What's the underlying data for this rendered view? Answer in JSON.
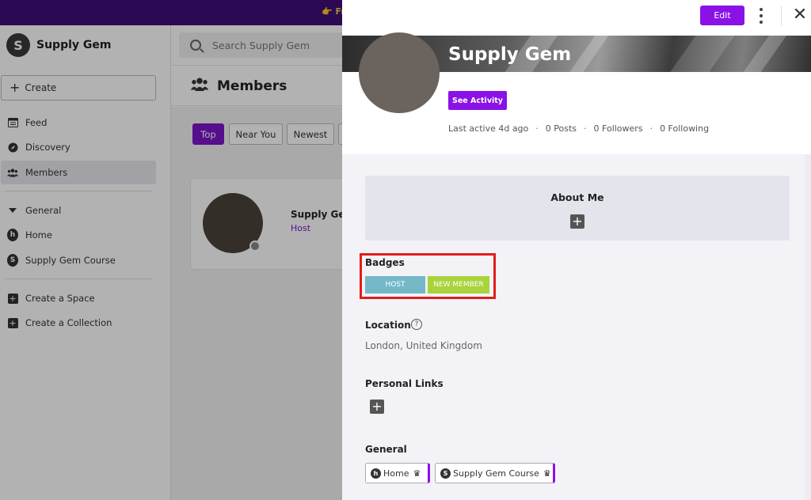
{
  "topbar": {
    "text": "👉 Fr"
  },
  "sidebar": {
    "brand": {
      "logo_letter": "S",
      "name": "Supply Gem"
    },
    "create_label": "Create",
    "items": [
      {
        "label": "Feed",
        "icon": "feed-icon"
      },
      {
        "label": "Discovery",
        "icon": "compass-icon"
      },
      {
        "label": "Members",
        "icon": "members-icon",
        "active": true
      }
    ],
    "group_label": "General",
    "spaces": [
      {
        "label": "Home",
        "icon_letter": "h"
      },
      {
        "label": "Supply Gem Course",
        "icon_letter": "S"
      }
    ],
    "actions": [
      {
        "label": "Create a Space"
      },
      {
        "label": "Create a Collection"
      }
    ]
  },
  "search": {
    "placeholder": "Search Supply Gem"
  },
  "main": {
    "title": "Members",
    "filters": [
      "Top",
      "Near You",
      "Newest"
    ],
    "active_filter": "Top",
    "member_card": {
      "name": "Supply Gem",
      "role": "Host"
    }
  },
  "panel": {
    "edit_label": "Edit",
    "close_symbol": "✕",
    "profile": {
      "name": "Supply Gem",
      "activity_button": "See Activity",
      "last_active": "Last active 4d ago",
      "posts": "0 Posts",
      "followers": "0 Followers",
      "following": "0 Following"
    },
    "about": {
      "title": "About Me"
    },
    "badges": {
      "title": "Badges",
      "items": [
        "HOST",
        "NEW MEMBER"
      ]
    },
    "location": {
      "title": "Location",
      "value": "London, United Kingdom"
    },
    "personal_links": {
      "title": "Personal Links"
    },
    "general": {
      "title": "General",
      "chips": [
        {
          "label": "Home",
          "icon_letter": "h"
        },
        {
          "label": "Supply Gem Course",
          "icon_letter": "S"
        }
      ]
    }
  },
  "colors": {
    "accent": "#8a12e6",
    "topbar": "#3f0f77",
    "badge_host": "#74b8c8",
    "badge_new_member": "#a8d33b",
    "highlight_box": "#e11d1d"
  }
}
